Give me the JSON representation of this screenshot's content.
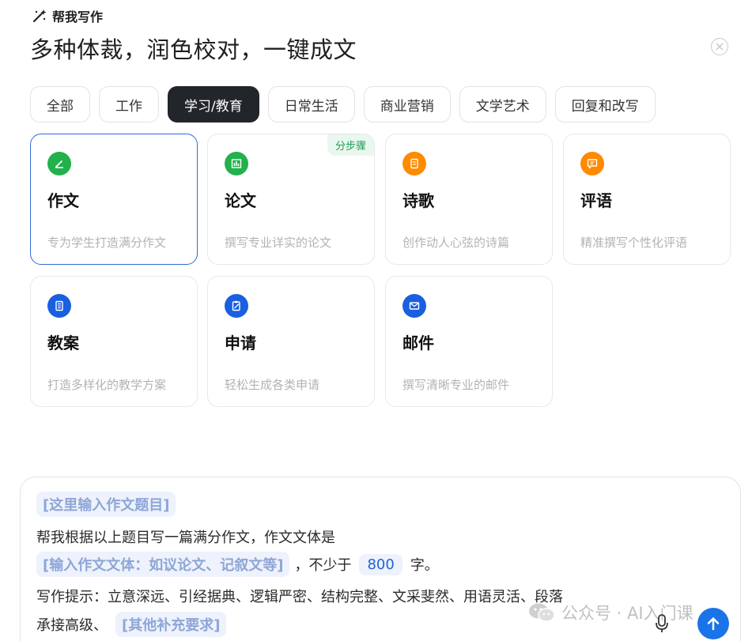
{
  "header": {
    "title": "帮我写作",
    "icon": "magic-wand-icon"
  },
  "subtitle": "多种体裁，润色校对，一键成文",
  "tabs": [
    {
      "label": "全部",
      "active": false
    },
    {
      "label": "工作",
      "active": false
    },
    {
      "label": "学习/教育",
      "active": true
    },
    {
      "label": "日常生活",
      "active": false
    },
    {
      "label": "商业营销",
      "active": false
    },
    {
      "label": "文学艺术",
      "active": false
    },
    {
      "label": "回复和改写",
      "active": false
    }
  ],
  "cards": [
    {
      "title": "作文",
      "desc": "专为学生打造满分作文",
      "icon": "pen-icon",
      "color": "#22b14c",
      "selected": true
    },
    {
      "title": "论文",
      "desc": "撰写专业详实的论文",
      "icon": "bar-chart-icon",
      "color": "#22b14c",
      "badge": "分步骤"
    },
    {
      "title": "诗歌",
      "desc": "创作动人心弦的诗篇",
      "icon": "document-icon",
      "color": "#ff8a00"
    },
    {
      "title": "评语",
      "desc": "精准撰写个性化评语",
      "icon": "comment-icon",
      "color": "#ff8a00"
    },
    {
      "title": "教案",
      "desc": "打造多样化的教学方案",
      "icon": "notebook-icon",
      "color": "#1a5fe0"
    },
    {
      "title": "申请",
      "desc": "轻松生成各类申请",
      "icon": "clipboard-edit-icon",
      "color": "#1a5fe0"
    },
    {
      "title": "邮件",
      "desc": "撰写清晰专业的邮件",
      "icon": "mail-icon",
      "color": "#1a5fe0"
    }
  ],
  "composer": {
    "slot_topic": "[这里输入作文题目]",
    "line2": "帮我根据以上题目写一篇满分作文，作文文体是",
    "slot_genre": "[输入作文文体：如议论文、记叙文等]",
    "min_words_prefix": "，不少于",
    "word_count": "800",
    "word_suffix": "字。",
    "hint_line": "写作提示：立意深远、引经据典、逻辑严密、结构完整、文采斐然、用语灵活、段落",
    "hint_cont": "承接高级、",
    "slot_other": "[其他补充要求]"
  },
  "watermark": {
    "text": "公众号 · AI入门课",
    "icon": "wechat-icon"
  },
  "colors": {
    "accent": "#1a73e8",
    "active_tab": "#22262b",
    "selected_border": "#2f6bd8"
  }
}
